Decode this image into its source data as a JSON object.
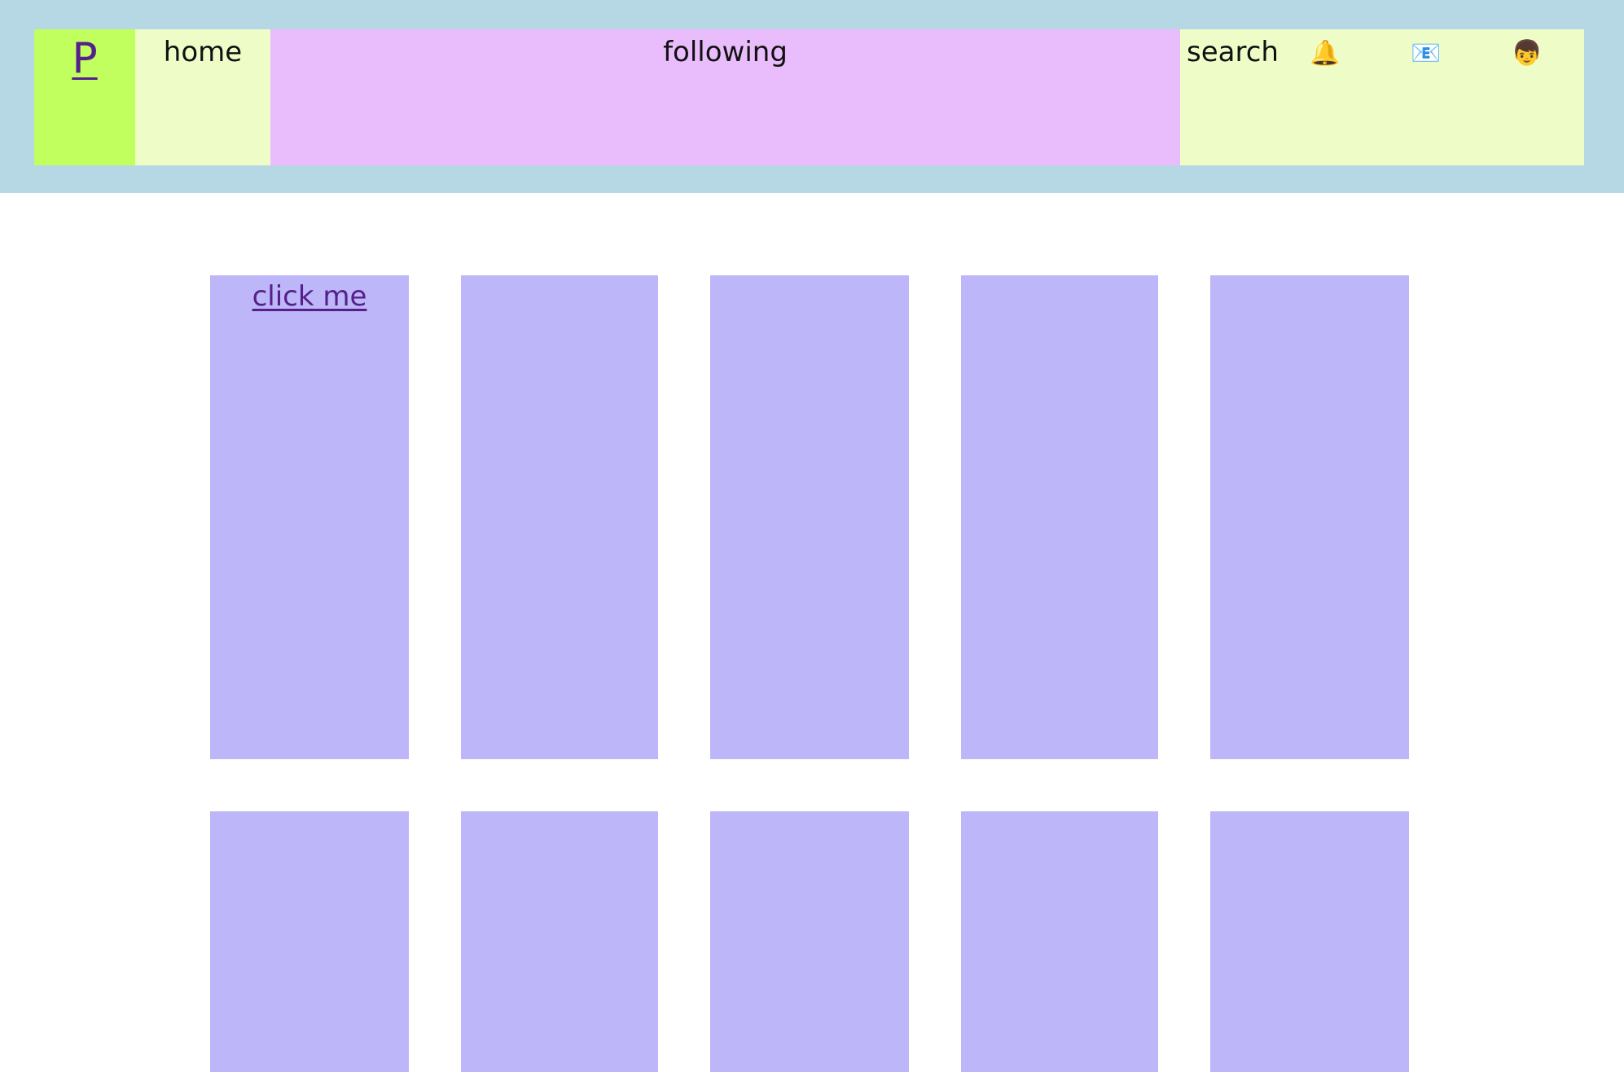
{
  "nav": {
    "logo_label": "P",
    "home_label": "home",
    "following_label": "following",
    "search_label": "search",
    "icons": {
      "notifications": "🔔",
      "messages": "📧",
      "profile": "👦"
    }
  },
  "cards": {
    "first_link_label": "click me"
  },
  "colors": {
    "header_bg": "#b6d8e4",
    "logo_bg": "#c0ff5d",
    "nav_item_bg": "#eefdc8",
    "following_bg": "#e9bdfb",
    "card_bg": "#bdb6f8",
    "link_color": "#55208b"
  }
}
